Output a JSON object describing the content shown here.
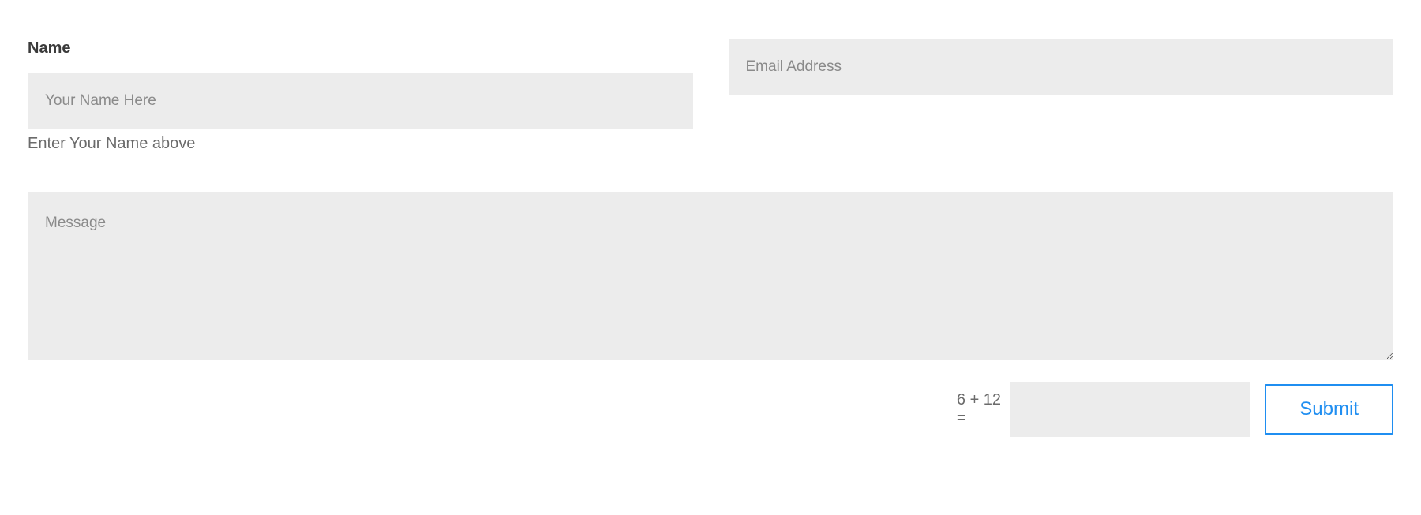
{
  "form": {
    "name": {
      "label": "Name",
      "placeholder": "Your Name Here",
      "hint": "Enter Your Name above"
    },
    "email": {
      "placeholder": "Email Address"
    },
    "message": {
      "placeholder": "Message"
    },
    "captcha": {
      "question": "6 + 12 ="
    },
    "submit_label": "Submit"
  }
}
